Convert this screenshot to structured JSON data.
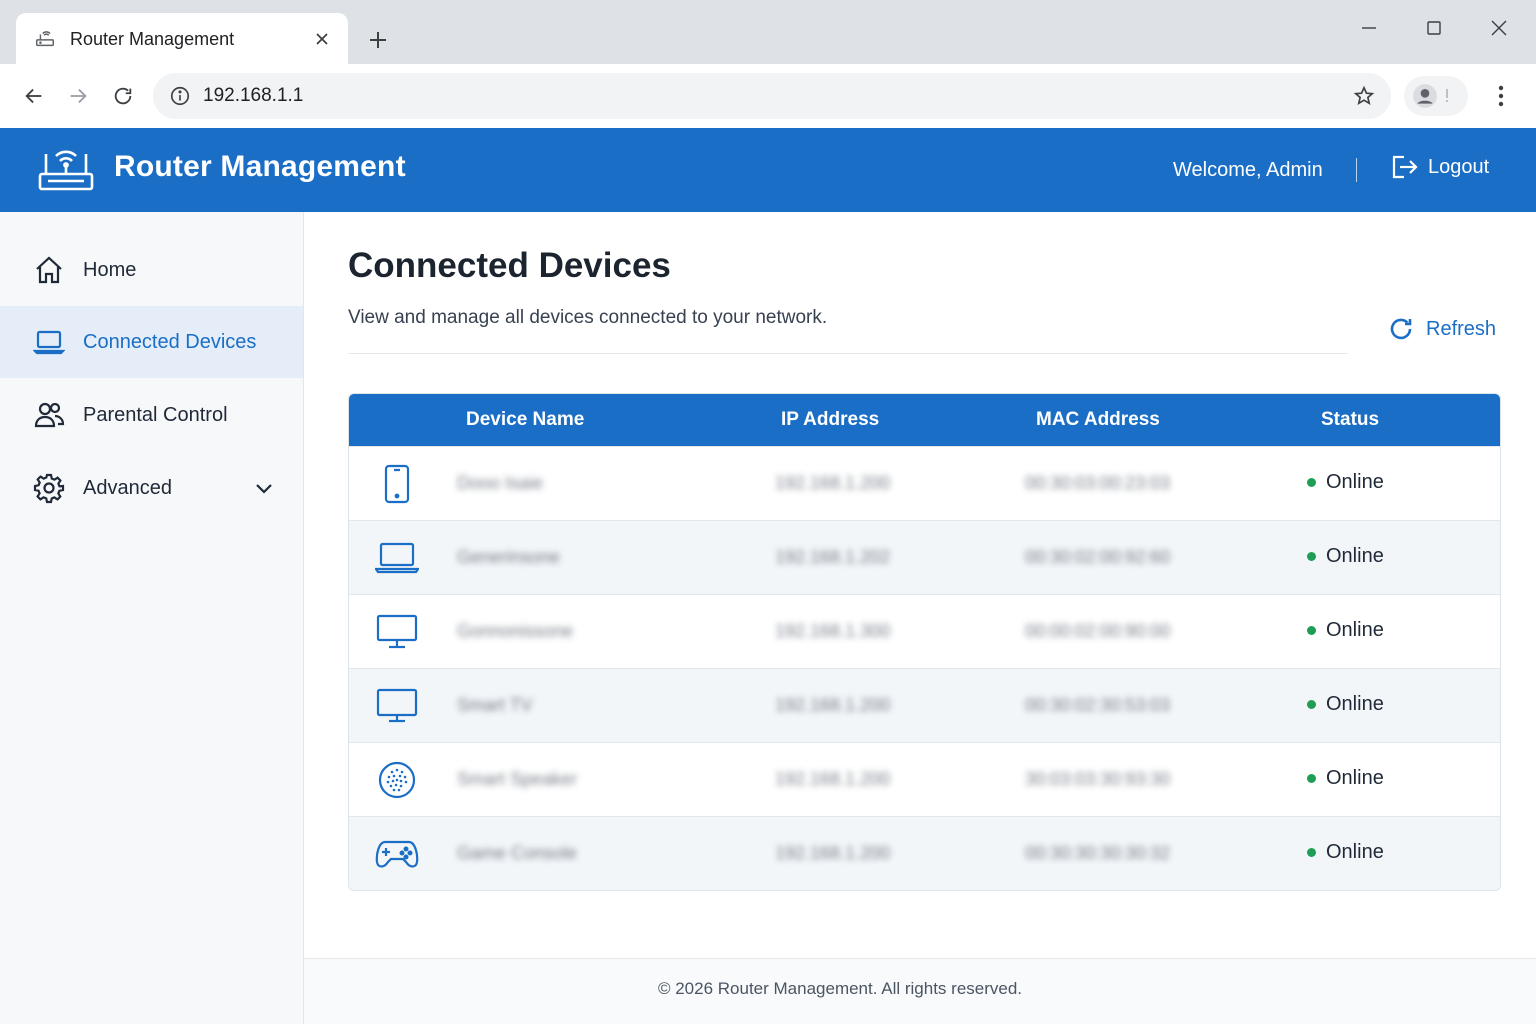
{
  "browser": {
    "tab_title": "Router Management",
    "url": "192.168.1.1"
  },
  "header": {
    "title": "Router Management",
    "welcome": "Welcome, Admin",
    "logout_label": "Logout"
  },
  "sidebar": {
    "items": [
      {
        "label": "Home",
        "icon": "home-icon"
      },
      {
        "label": "Connected Devices",
        "icon": "laptop-icon",
        "active": true
      },
      {
        "label": "Parental Control",
        "icon": "users-icon"
      },
      {
        "label": "Advanced",
        "icon": "gear-icon"
      }
    ]
  },
  "main": {
    "title": "Connected Devices",
    "subtitle": "View and manage all devices connected to your network.",
    "refresh_label": "Refresh"
  },
  "table": {
    "headers": [
      "Device Name",
      "IP Address",
      "MAC Address",
      "Status"
    ],
    "rows": [
      {
        "icon": "smartphone-icon",
        "name": "Dooo Isaie",
        "ip": "192.168.1.200",
        "mac": "00:30:03:00:23:03",
        "status": "Online"
      },
      {
        "icon": "laptop-icon",
        "name": "Generinsone",
        "ip": "192.168.1.202",
        "mac": "00:30:02:00:92:60",
        "status": "Online"
      },
      {
        "icon": "desktop-icon",
        "name": "Gonnonissone",
        "ip": "192.168.1.300",
        "mac": "00:00:02:00:90:00",
        "status": "Online"
      },
      {
        "icon": "tv-icon",
        "name": "Smart TV",
        "ip": "192.168.1.200",
        "mac": "00:30:02:30:53:03",
        "status": "Online"
      },
      {
        "icon": "speaker-icon",
        "name": "Smart Speaker",
        "ip": "192.168.1.200",
        "mac": "30:03:03:30:93:30",
        "status": "Online"
      },
      {
        "icon": "gamepad-icon",
        "name": "Game Console",
        "ip": "192.168.1.200",
        "mac": "00:30:30:30:30:32",
        "status": "Online"
      }
    ]
  },
  "footer": {
    "text": "© 2026 Router Management. All rights reserved."
  },
  "colors": {
    "brand": "#1a6ec6",
    "online": "#1f9d55"
  }
}
